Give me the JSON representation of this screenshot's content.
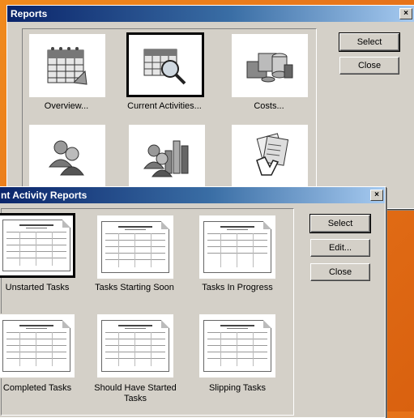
{
  "reports_dialog": {
    "title": "Reports",
    "close_glyph": "×",
    "tiles": [
      {
        "label": "Overview...",
        "icon": "calendar-icon"
      },
      {
        "label": "Current Activities...",
        "icon": "calendar-magnifier-icon"
      },
      {
        "label": "Costs...",
        "icon": "coins-icon"
      },
      {
        "label": "",
        "icon": "people-icon"
      },
      {
        "label": "",
        "icon": "people-chart-icon"
      },
      {
        "label": "",
        "icon": "hand-documents-icon"
      }
    ],
    "buttons": {
      "select": "Select",
      "close": "Close"
    }
  },
  "activity_dialog": {
    "title": "nt Activity Reports",
    "close_glyph": "×",
    "reports": [
      {
        "label": "Unstarted Tasks"
      },
      {
        "label": "Tasks Starting Soon"
      },
      {
        "label": "Tasks In Progress"
      },
      {
        "label": "Completed Tasks"
      },
      {
        "label": "Should Have Started Tasks"
      },
      {
        "label": "Slipping Tasks"
      }
    ],
    "buttons": {
      "select": "Select",
      "edit": "Edit...",
      "close": "Close"
    }
  },
  "colors": {
    "titlebar_start": "#0a246a",
    "titlebar_end": "#a6caf0",
    "dialog_face": "#d4d0c8",
    "desktop": "#e7741a"
  }
}
